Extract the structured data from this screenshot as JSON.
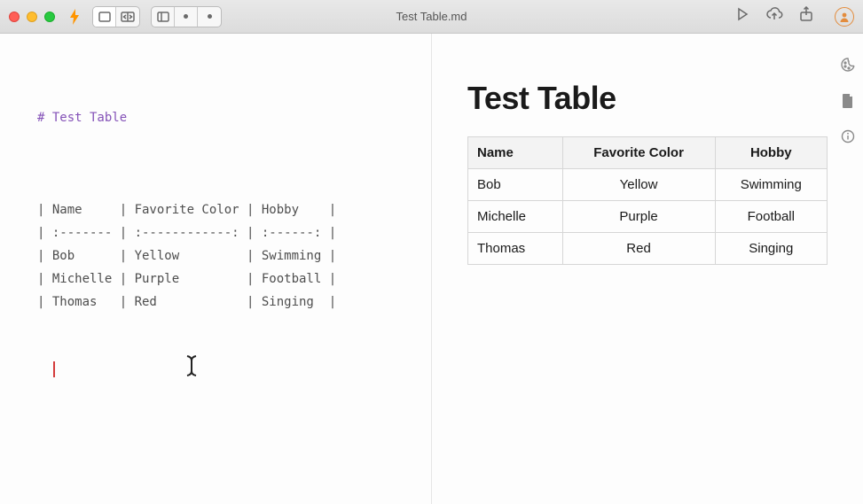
{
  "window": {
    "filename": "Test Table.md"
  },
  "editor": {
    "heading": "# Test Table",
    "lines": [
      "| Name     | Favorite Color | Hobby    |",
      "| :------- | :------------: | :------: |",
      "| Bob      | Yellow         | Swimming |",
      "| Michelle | Purple         | Football |",
      "| Thomas   | Red            | Singing  |"
    ]
  },
  "preview": {
    "title": "Test Table",
    "columns": [
      "Name",
      "Favorite Color",
      "Hobby"
    ],
    "rows": [
      [
        "Bob",
        "Yellow",
        "Swimming"
      ],
      [
        "Michelle",
        "Purple",
        "Football"
      ],
      [
        "Thomas",
        "Red",
        "Singing"
      ]
    ]
  }
}
